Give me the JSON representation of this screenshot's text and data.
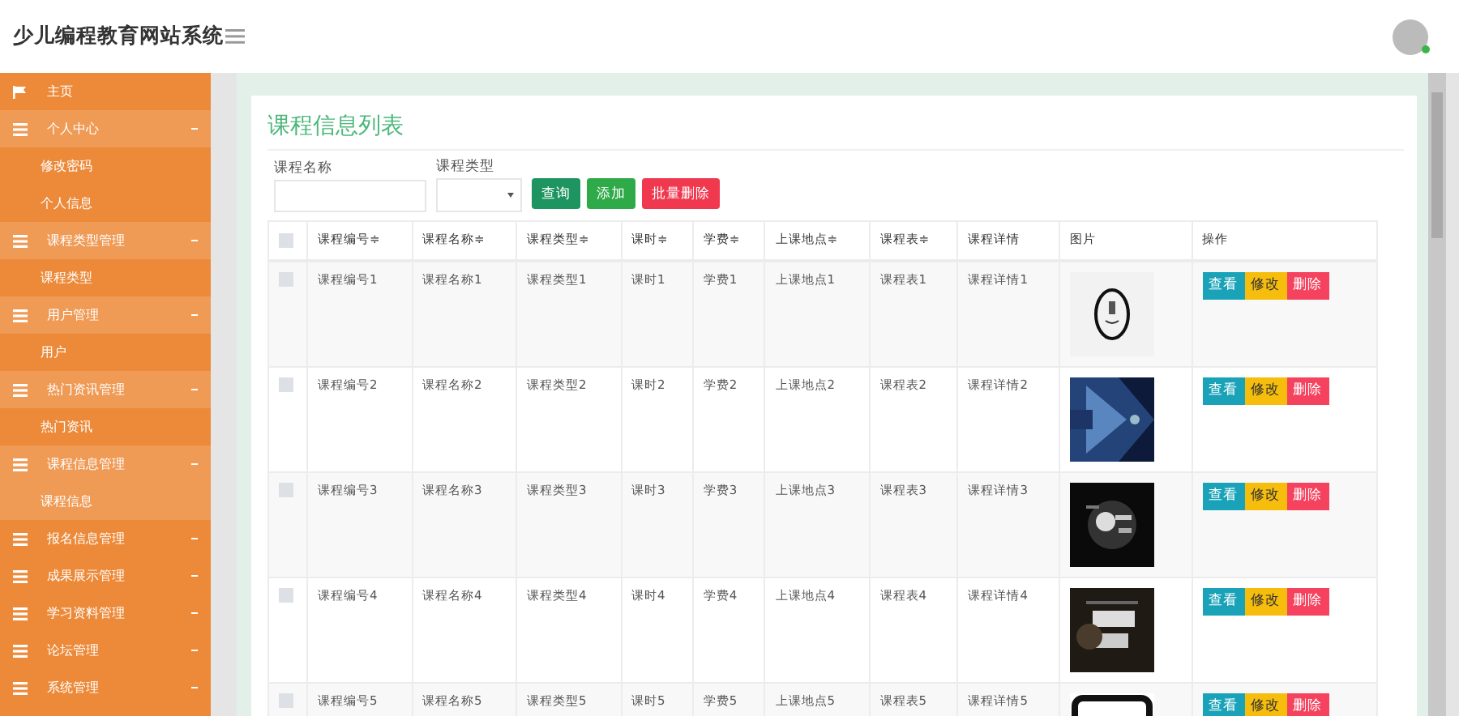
{
  "header": {
    "title": "少儿编程教育网站系统"
  },
  "sidebar": {
    "items": [
      {
        "label": "主页",
        "kind": "link",
        "expanded": false
      },
      {
        "label": "个人中心",
        "kind": "group",
        "expanded": true,
        "children": [
          {
            "label": "修改密码",
            "selected": false
          },
          {
            "label": "个人信息",
            "selected": false
          }
        ]
      },
      {
        "label": "课程类型管理",
        "kind": "group",
        "expanded": true,
        "children": [
          {
            "label": "课程类型",
            "selected": false
          }
        ]
      },
      {
        "label": "用户管理",
        "kind": "group",
        "expanded": true,
        "children": [
          {
            "label": "用户",
            "selected": false
          }
        ]
      },
      {
        "label": "热门资讯管理",
        "kind": "group",
        "expanded": true,
        "children": [
          {
            "label": "热门资讯",
            "selected": false
          }
        ]
      },
      {
        "label": "课程信息管理",
        "kind": "group",
        "expanded": true,
        "children": [
          {
            "label": "课程信息",
            "selected": true
          }
        ]
      },
      {
        "label": "报名信息管理",
        "kind": "group",
        "expanded": false
      },
      {
        "label": "成果展示管理",
        "kind": "group",
        "expanded": false
      },
      {
        "label": "学习资料管理",
        "kind": "group",
        "expanded": false
      },
      {
        "label": "论坛管理",
        "kind": "group",
        "expanded": false
      },
      {
        "label": "系统管理",
        "kind": "group",
        "expanded": false
      }
    ]
  },
  "panel": {
    "title": "课程信息列表",
    "filters": [
      {
        "label": "课程名称",
        "kind": "text"
      },
      {
        "label": "课程类型",
        "kind": "select"
      }
    ],
    "buttons": [
      {
        "label": "查询",
        "kind": "search"
      },
      {
        "label": "添加",
        "kind": "add"
      },
      {
        "label": "批量删除",
        "kind": "delete"
      }
    ],
    "table": {
      "all_checked": false,
      "columns": [
        "课程编号≑",
        "课程名称≑",
        "课程类型≑",
        "课时≑",
        "学费≑",
        "上课地点≑",
        "课程表≑",
        "课程详情",
        "图片",
        "操作"
      ],
      "rows": [
        {
          "cells": [
            "课程编号1",
            "课程名称1",
            "课程类型1",
            "课时1",
            "学费1",
            "上课地点1",
            "课程表1",
            "课程详情1"
          ],
          "checked": false,
          "actions": [
            "查看",
            "修改",
            "删除"
          ]
        },
        {
          "cells": [
            "课程编号2",
            "课程名称2",
            "课程类型2",
            "课时2",
            "学费2",
            "上课地点2",
            "课程表2",
            "课程详情2"
          ],
          "checked": false,
          "actions": [
            "查看",
            "修改",
            "删除"
          ]
        },
        {
          "cells": [
            "课程编号3",
            "课程名称3",
            "课程类型3",
            "课时3",
            "学费3",
            "上课地点3",
            "课程表3",
            "课程详情3"
          ],
          "checked": false,
          "actions": [
            "查看",
            "修改",
            "删除"
          ]
        },
        {
          "cells": [
            "课程编号4",
            "课程名称4",
            "课程类型4",
            "课时4",
            "学费4",
            "上课地点4",
            "课程表4",
            "课程详情4"
          ],
          "checked": false,
          "actions": [
            "查看",
            "修改",
            "删除"
          ]
        },
        {
          "cells": [
            "课程编号5",
            "课程名称5",
            "课程类型5",
            "课时5",
            "学费5",
            "上课地点5",
            "课程表5",
            "课程详情5"
          ],
          "checked": false,
          "actions": [
            "查看",
            "修改",
            "删除"
          ]
        }
      ]
    }
  }
}
